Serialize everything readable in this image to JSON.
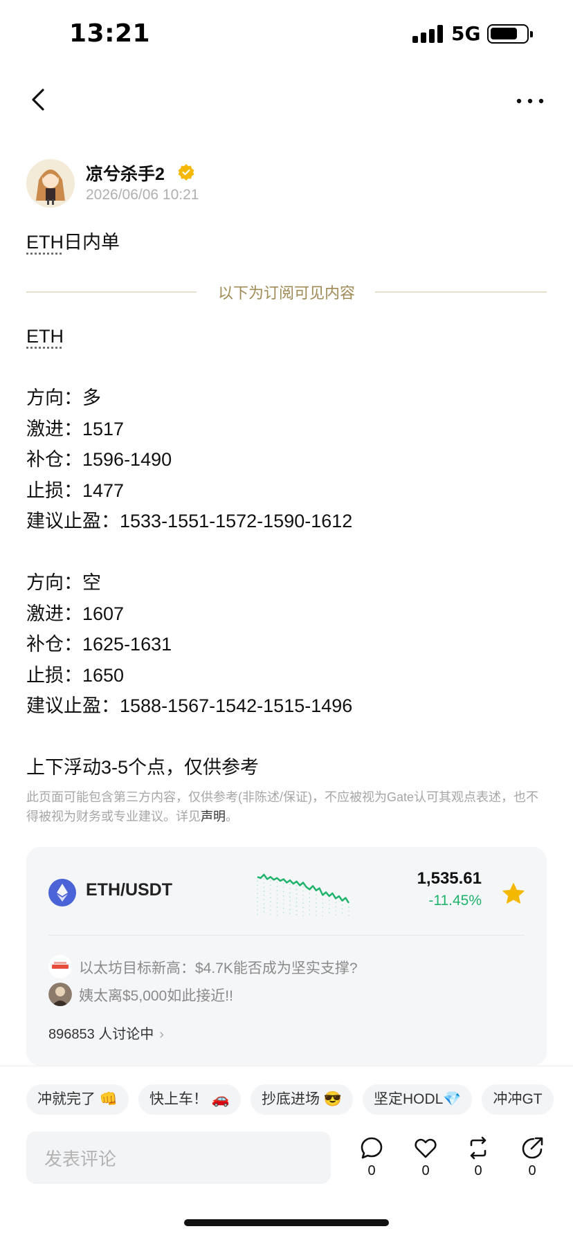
{
  "status_bar": {
    "time": "13:21",
    "network": "5G"
  },
  "author": {
    "name": "凉兮杀手2",
    "date": "2026/06/06 10:21"
  },
  "post": {
    "title_prefix": "ETH",
    "title_suffix": "日内单",
    "subscriber_divider": "以下为订阅可见内容",
    "symbol": "ETH",
    "long": {
      "direction": "方向：多",
      "aggressive": "激进：1517",
      "add_position": "补仓：1596-1490",
      "stop_loss": "止损：1477",
      "take_profit": "建议止盈：1533-1551-1572-1590-1612"
    },
    "short": {
      "direction": "方向：空",
      "aggressive": "激进：1607",
      "add_position": "补仓：1625-1631",
      "stop_loss": "止损：1650",
      "take_profit": "建议止盈：1588-1567-1542-1515-1496"
    },
    "note": "上下浮动3-5个点，仅供参考"
  },
  "disclaimer": {
    "text": "此页面可能包含第三方内容，仅供参考(非陈述/保证)，不应被视为Gate认可其观点表述，也不得被视为财务或专业建议。详见",
    "link": "声明",
    "end": "。"
  },
  "market_card": {
    "pair": "ETH/USDT",
    "price": "1,535.61",
    "change": "-11.45%",
    "sparkline": [
      62,
      60,
      66,
      58,
      62,
      57,
      60,
      55,
      58,
      52,
      56,
      50,
      54,
      47,
      52,
      44,
      40,
      46,
      38,
      42,
      30,
      35,
      28,
      33,
      24,
      28,
      20,
      25,
      16
    ],
    "news": [
      {
        "text": "以太坊目标新高：$4.7K能否成为坚实支撑?"
      },
      {
        "text": "姨太离$5,000如此接近!!"
      }
    ],
    "discussion": "896853 人讨论中"
  },
  "quick_replies": [
    "冲就完了 👊",
    "快上车！ 🚗",
    "抄底进场 😎",
    "坚定HODL💎",
    "冲冲GT"
  ],
  "comment": {
    "placeholder": "发表评论"
  },
  "actions": {
    "comments": "0",
    "likes": "0",
    "reposts": "0",
    "shares": "0"
  },
  "colors": {
    "positive": "#1fb36b",
    "accent_gold": "#a08a55",
    "eth_blue": "#4a63d6",
    "star": "#f5b800"
  }
}
